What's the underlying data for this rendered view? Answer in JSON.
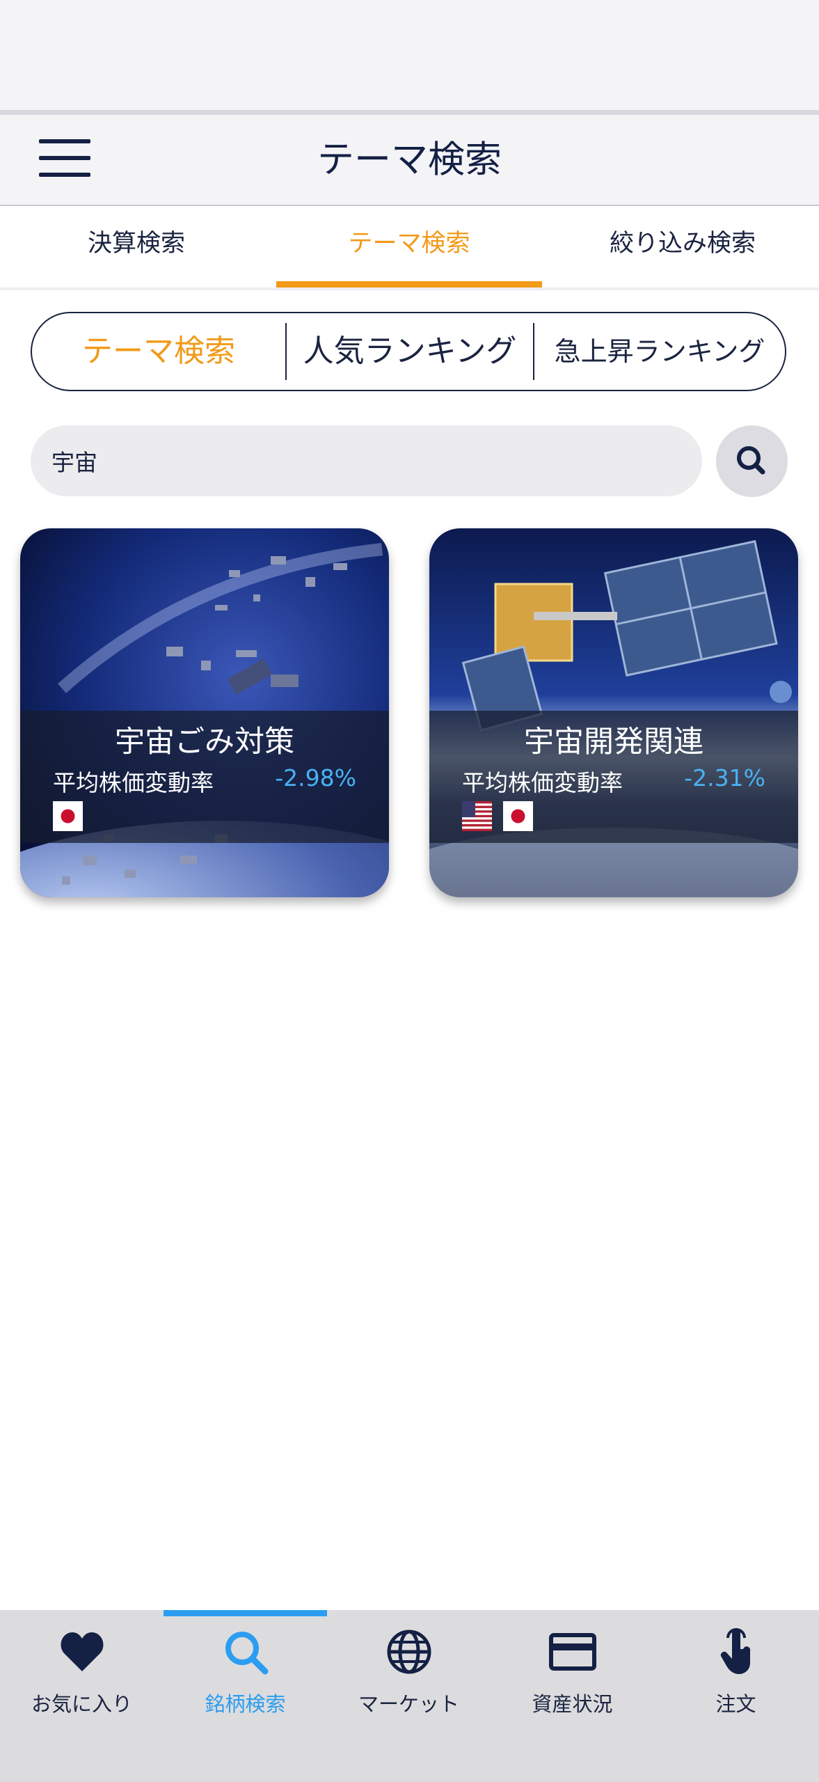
{
  "header": {
    "title": "テーマ検索"
  },
  "top_tabs": [
    {
      "label": "決算検索",
      "active": false
    },
    {
      "label": "テーマ検索",
      "active": true
    },
    {
      "label": "絞り込み検索",
      "active": false
    }
  ],
  "segment": [
    {
      "label": "テーマ検索",
      "active": true
    },
    {
      "label": "人気ランキング",
      "active": false
    },
    {
      "label": "急上昇ランキング",
      "active": false
    }
  ],
  "search": {
    "value": "宇宙",
    "icon": "search-icon"
  },
  "cards": [
    {
      "title": "宇宙ごみ対策",
      "metric_label": "平均株価変動率",
      "metric_value": "-2.98%",
      "flags": [
        "jp-flag-icon"
      ]
    },
    {
      "title": "宇宙開発関連",
      "metric_label": "平均株価変動率",
      "metric_value": "-2.31%",
      "flags": [
        "us-flag-icon",
        "jp-flag-icon"
      ]
    }
  ],
  "bottom_nav": [
    {
      "label": "お気に入り",
      "icon": "heart-icon",
      "active": false
    },
    {
      "label": "銘柄検索",
      "icon": "search-icon",
      "active": true
    },
    {
      "label": "マーケット",
      "icon": "globe-icon",
      "active": false
    },
    {
      "label": "資産状況",
      "icon": "card-icon",
      "active": false
    },
    {
      "label": "注文",
      "icon": "tap-icon",
      "active": false
    }
  ],
  "colors": {
    "accent": "#f29a1a",
    "nav_active": "#2c9df0",
    "negative": "#4ab2f2",
    "text": "#1a2340"
  }
}
